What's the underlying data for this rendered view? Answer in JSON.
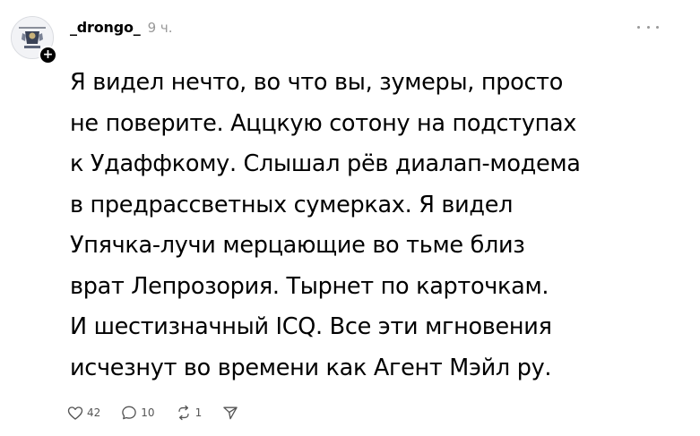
{
  "post": {
    "username": "_drongo_",
    "timestamp": "9 ч.",
    "text_lines": [
      "Я видел нечто, во что вы, зумеры, просто",
      "не поверите. Аццкую сотону на подступах",
      "к Удаффкому. Слышал рёв диалап-модема",
      "в предрассветных сумерках. Я видел",
      "Упячка-лучи мерцающие во тьме близ",
      "врат Лепрозория. Тырнет по карточкам.",
      "И шестизначный ICQ. Все эти мгновения",
      "исчезнут во времени как Агент Мэйл ру."
    ],
    "actions": {
      "likes": "42",
      "comments": "10",
      "reposts": "1"
    }
  },
  "icons": {
    "avatar": "avatar-image",
    "follow": "plus-icon",
    "more": "more-dots-icon",
    "like": "heart-icon",
    "comment": "comment-icon",
    "repost": "repost-icon",
    "share": "share-icon"
  },
  "colors": {
    "text": "#000000",
    "muted": "#999999",
    "icon": "#555555"
  }
}
